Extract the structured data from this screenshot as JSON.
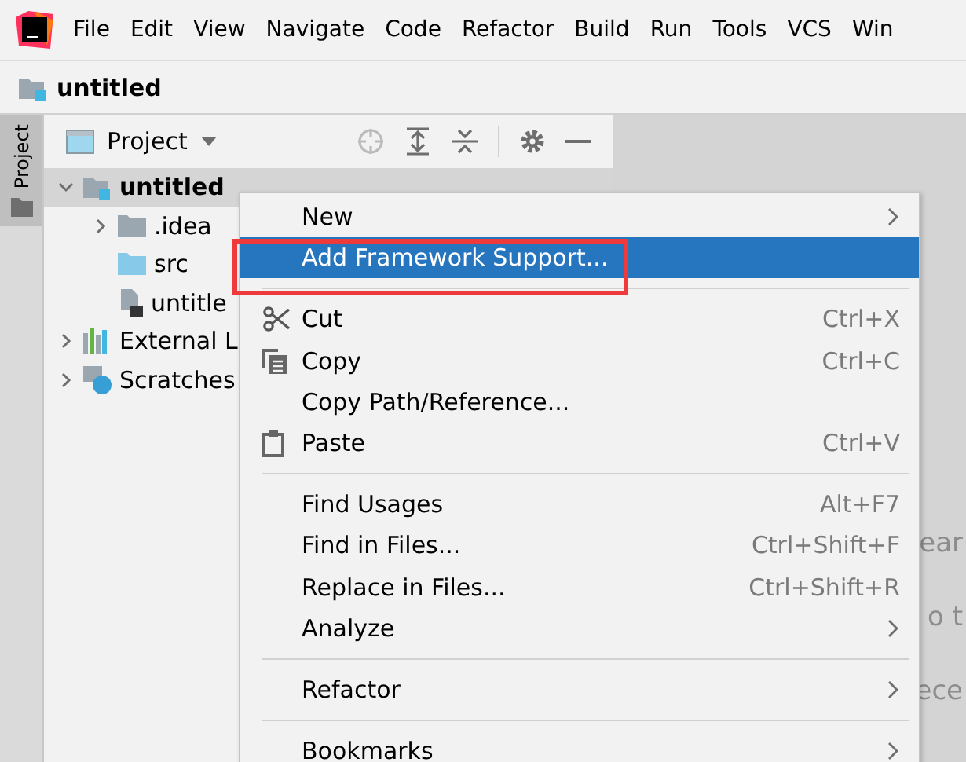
{
  "menu_bar": [
    "File",
    "Edit",
    "View",
    "Navigate",
    "Code",
    "Refactor",
    "Build",
    "Run",
    "Tools",
    "VCS",
    "Win"
  ],
  "breadcrumb": "untitled",
  "side_strip": {
    "tab": "Project"
  },
  "project_panel": {
    "title": "Project"
  },
  "tree": [
    {
      "label": "untitled",
      "kind": "module",
      "expanded": true,
      "selected": true,
      "children": [
        {
          "label": ".idea",
          "kind": "folder",
          "expanded": false,
          "selected": false
        },
        {
          "label": "src",
          "kind": "source",
          "selected": false
        },
        {
          "label": "untitle",
          "kind": "file",
          "selected": false
        }
      ]
    },
    {
      "label": "External L",
      "kind": "library",
      "expanded": false,
      "selected": false
    },
    {
      "label": "Scratches",
      "kind": "scratch",
      "expanded": false,
      "selected": false
    }
  ],
  "editor_hints": [
    "ear",
    "o t",
    "ece"
  ],
  "context_menu": [
    {
      "kind": "item",
      "label": "New",
      "submenu": true,
      "selected": false
    },
    {
      "kind": "item",
      "label": "Add Framework Support...",
      "selected": true,
      "highlighted": true
    },
    {
      "kind": "separator"
    },
    {
      "kind": "cut",
      "label": "Cut",
      "shortcut": "Ctrl+X",
      "selected": false
    },
    {
      "kind": "copy",
      "label": "Copy",
      "shortcut": "Ctrl+C",
      "selected": false
    },
    {
      "kind": "item",
      "label": "Copy Path/Reference...",
      "selected": false
    },
    {
      "kind": "paste",
      "label": "Paste",
      "shortcut": "Ctrl+V",
      "selected": false
    },
    {
      "kind": "separator"
    },
    {
      "kind": "item",
      "label": "Find Usages",
      "shortcut": "Alt+F7",
      "selected": false
    },
    {
      "kind": "item",
      "label": "Find in Files...",
      "shortcut": "Ctrl+Shift+F",
      "selected": false
    },
    {
      "kind": "item",
      "label": "Replace in Files...",
      "shortcut": "Ctrl+Shift+R",
      "selected": false
    },
    {
      "kind": "item",
      "label": "Analyze",
      "submenu": true,
      "selected": false
    },
    {
      "kind": "separator"
    },
    {
      "kind": "item",
      "label": "Refactor",
      "submenu": true,
      "selected": false
    },
    {
      "kind": "separator"
    },
    {
      "kind": "item",
      "label": "Bookmarks",
      "submenu": true,
      "selected": false
    }
  ]
}
